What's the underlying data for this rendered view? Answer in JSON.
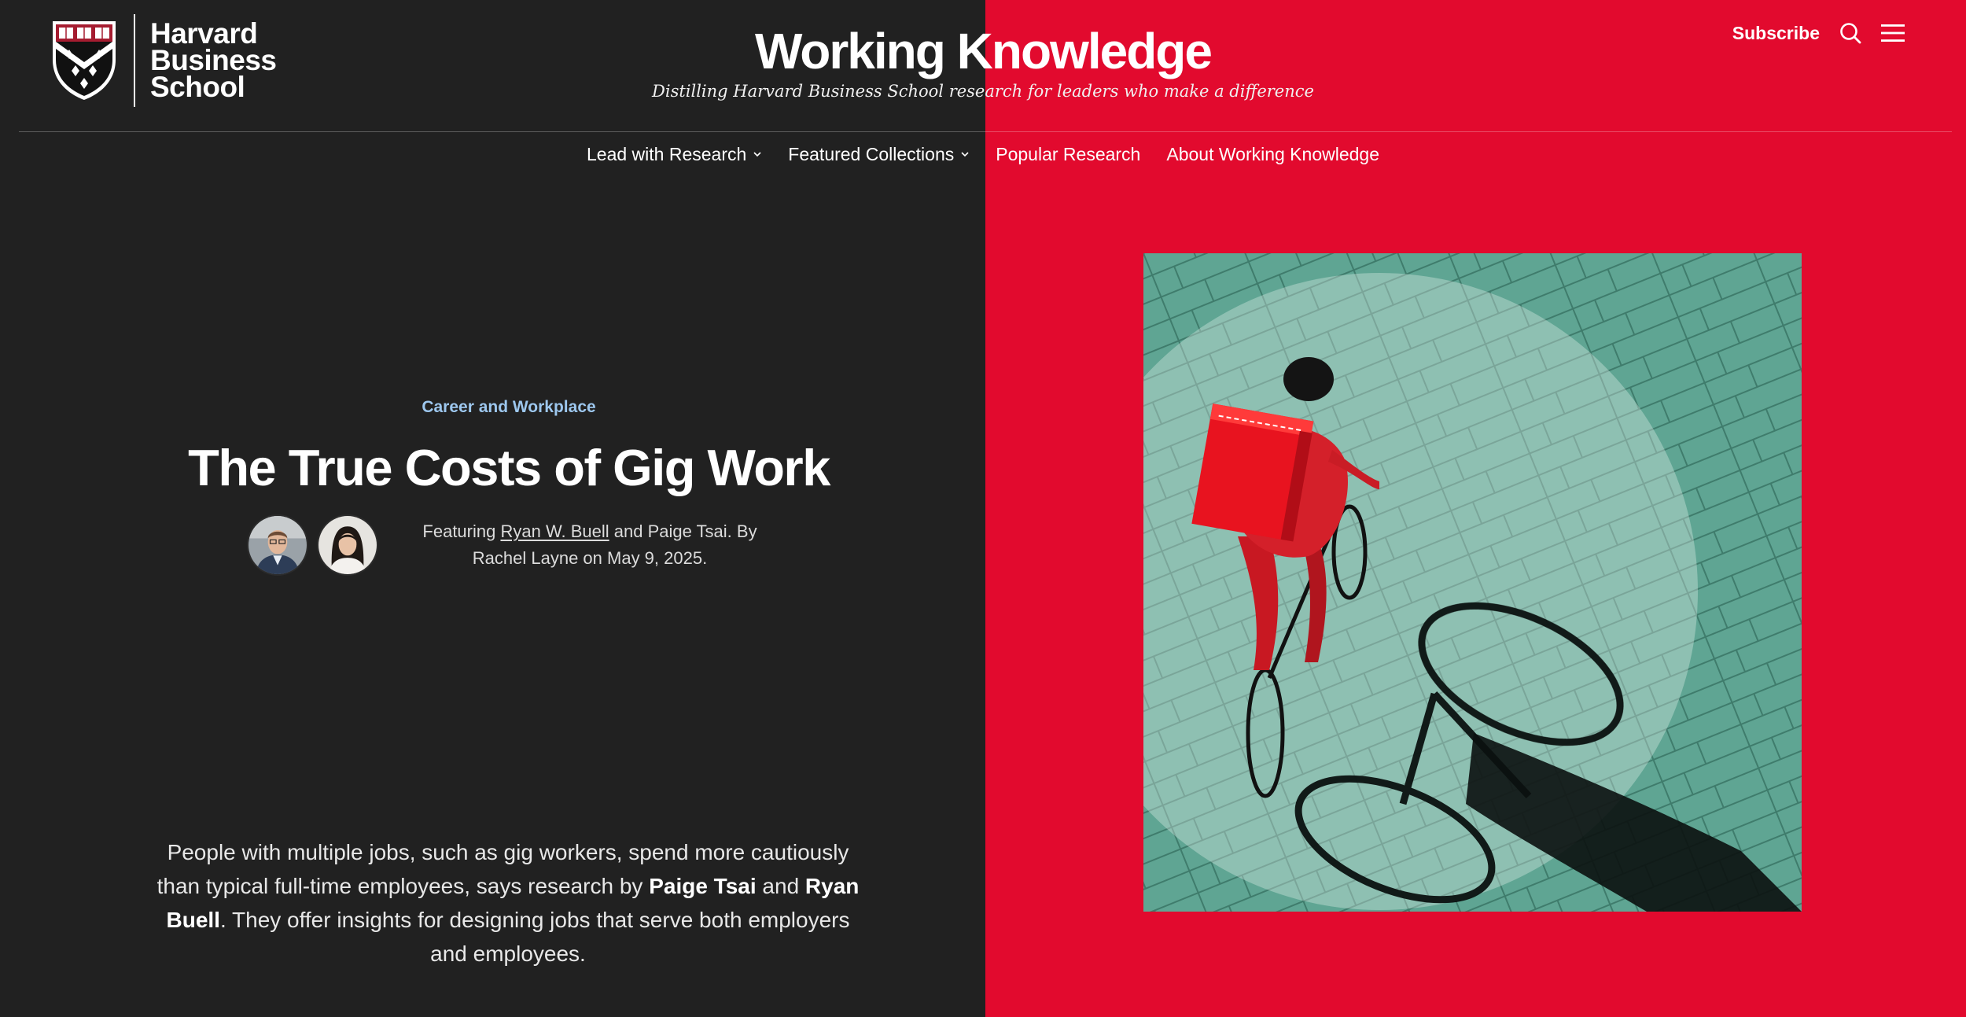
{
  "header": {
    "logo_lines": [
      "Harvard",
      "Business",
      "School"
    ],
    "title": "Working Knowledge",
    "tagline": "Distilling Harvard Business School research for leaders who make a difference",
    "subscribe_label": "Subscribe",
    "icons": [
      "search-icon",
      "menu-icon"
    ]
  },
  "nav": {
    "items": [
      {
        "label": "Lead with Research",
        "has_dropdown": true
      },
      {
        "label": "Featured Collections",
        "has_dropdown": true
      },
      {
        "label": "Popular Research",
        "has_dropdown": false
      },
      {
        "label": "About Working Knowledge",
        "has_dropdown": false
      }
    ]
  },
  "article": {
    "category": "Career and Workplace",
    "title": "The True Costs of Gig Work",
    "byline": {
      "featuring_prefix": "Featuring ",
      "author_link": "Ryan W. Buell",
      "middle": " and Paige Tsai. By Rachel Layne on May 9, 2025."
    },
    "dek": {
      "part1": "People with multiple jobs, such as gig workers, spend more cautiously than typical full-time employees, says research by ",
      "bold1": "Paige Tsai",
      "part2": " and ",
      "bold2": "Ryan Buell",
      "part3": ". They offer insights for designing jobs that serve both employers and employees."
    }
  },
  "colors": {
    "left_bg": "#212121",
    "right_bg": "#e20a2e",
    "kicker": "#9dc7ee"
  }
}
